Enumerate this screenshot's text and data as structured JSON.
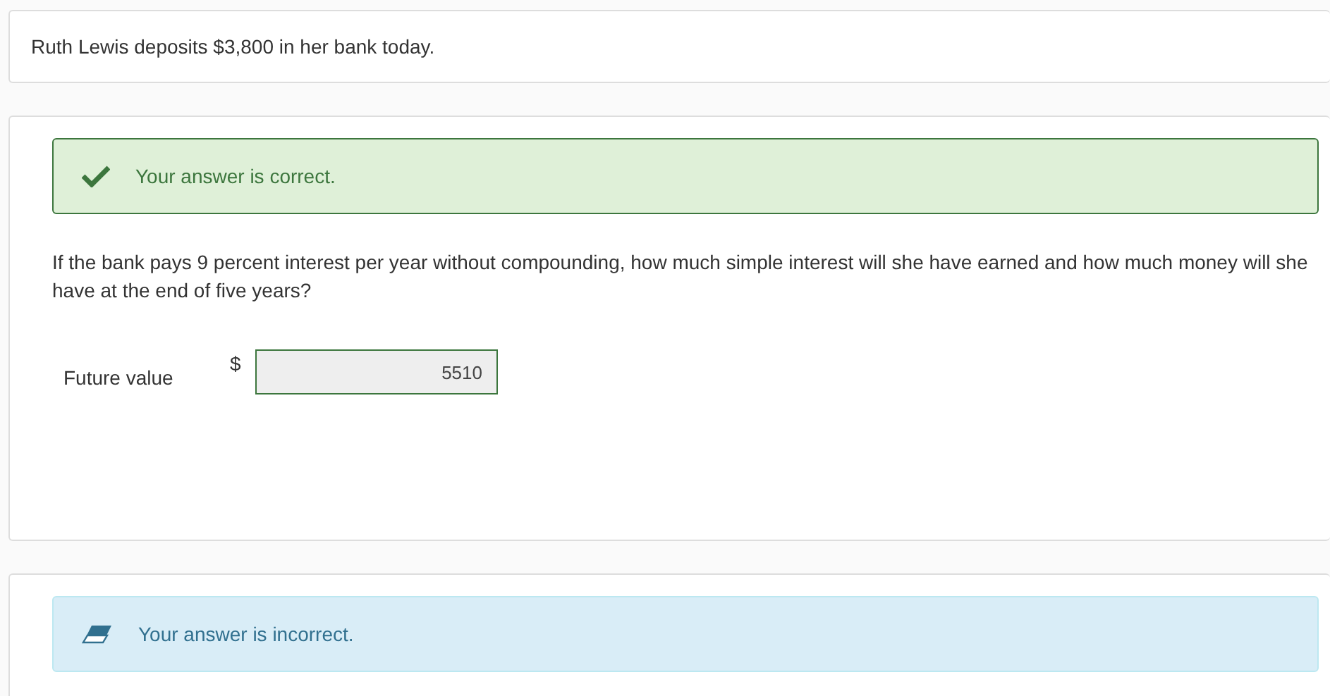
{
  "intro": "Ruth Lewis deposits $3,800 in her bank today.",
  "part": {
    "alert": {
      "kind": "correct",
      "text": "Your answer is correct."
    },
    "question": "If the bank pays 9 percent interest per year without compounding, how much simple interest will she have earned and how much money will she have at the end of five years?",
    "field": {
      "label": "Future value",
      "currency": "$",
      "value": "5510",
      "correct": true
    }
  },
  "next_alert": {
    "kind": "incorrect",
    "text": "Your answer is incorrect."
  }
}
